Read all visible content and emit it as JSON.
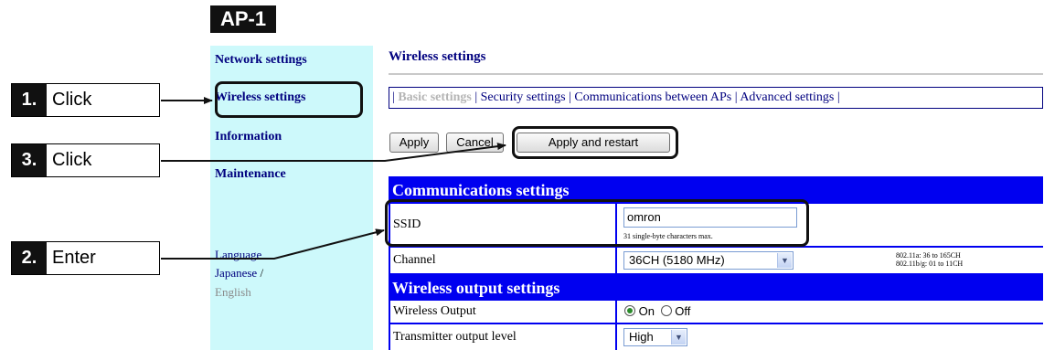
{
  "device_label": "AP-1",
  "sidebar": {
    "items": [
      {
        "label": "Network settings"
      },
      {
        "label": "Wireless settings"
      },
      {
        "label": "Information"
      },
      {
        "label": "Maintenance"
      }
    ],
    "language_label": "Language",
    "language_japanese": "Japanese",
    "language_separator": "/",
    "language_english": "English"
  },
  "main": {
    "title": "Wireless settings",
    "tabs": [
      {
        "label": "Basic settings",
        "active": true
      },
      {
        "label": "Security settings"
      },
      {
        "label": "Communications between APs"
      },
      {
        "label": "Advanced settings"
      }
    ],
    "tab_separator": "|",
    "buttons": {
      "apply": "Apply",
      "cancel": "Cancel",
      "apply_restart": "Apply and restart"
    }
  },
  "settings": {
    "communications_header": "Communications settings",
    "ssid_label": "SSID",
    "ssid_value": "omron",
    "ssid_hint": "31 single-byte characters max.",
    "channel_label": "Channel",
    "channel_value": "36CH (5180 MHz)",
    "channel_note_a": "802.11a: 36 to 165CH",
    "channel_note_bg": "802.11b/g: 01 to 11CH",
    "wireless_output_header": "Wireless output settings",
    "wireless_output_label": "Wireless Output",
    "wireless_output_on": "On",
    "wireless_output_off": "Off",
    "wireless_output_selected": "On",
    "tx_level_label": "Transmitter output level",
    "tx_level_value": "High"
  },
  "callouts": [
    {
      "number": "1.",
      "text": "Click"
    },
    {
      "number": "3.",
      "text": "Click"
    },
    {
      "number": "2.",
      "text": "Enter"
    }
  ],
  "colors": {
    "sidebar_bg": "#cdf9fb",
    "nav_link": "#00007f",
    "section_bg": "#0000f0"
  }
}
